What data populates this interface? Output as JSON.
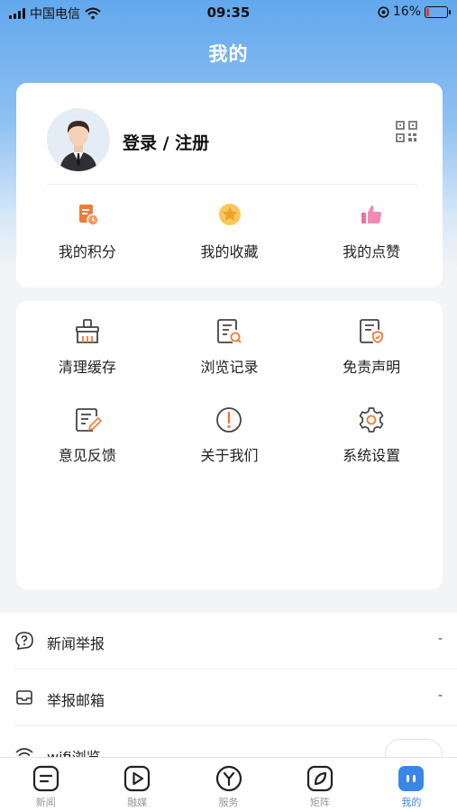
{
  "status_bar": {
    "carrier": "中国电信",
    "time": "09:35",
    "battery_percent": "16%",
    "battery_level": 0.16,
    "battery_color": "#e2402a"
  },
  "header": {
    "title": "我的"
  },
  "profile": {
    "login_label": "登录 / 注册",
    "avatar_icon": "user-avatar-icon",
    "qr_icon": "qr-code-icon"
  },
  "stats": [
    {
      "label": "我的积分",
      "icon": "points-icon",
      "color": "#f07a3a"
    },
    {
      "label": "我的收藏",
      "icon": "star-icon",
      "color": "#f2a93b"
    },
    {
      "label": "我的点赞",
      "icon": "thumb-up-icon",
      "color": "#ee6fa0"
    }
  ],
  "functions": [
    {
      "label": "清理缓存",
      "icon": "broom-icon"
    },
    {
      "label": "浏览记录",
      "icon": "history-icon"
    },
    {
      "label": "免责声明",
      "icon": "disclaimer-icon"
    },
    {
      "label": "意见反馈",
      "icon": "feedback-icon"
    },
    {
      "label": "关于我们",
      "icon": "info-icon"
    },
    {
      "label": "系统设置",
      "icon": "settings-icon"
    }
  ],
  "list": [
    {
      "label": "新闻举报",
      "value": "-",
      "icon": "report-icon"
    },
    {
      "label": "举报邮箱",
      "value": "-",
      "icon": "mailbox-icon"
    },
    {
      "label": "wifi浏览",
      "icon": "wifi-icon"
    }
  ],
  "tabs": [
    {
      "label": "新闻",
      "icon": "news-tab-icon"
    },
    {
      "label": "融媒",
      "icon": "media-tab-icon"
    },
    {
      "label": "服务",
      "icon": "service-tab-icon"
    },
    {
      "label": "矩阵",
      "icon": "matrix-tab-icon"
    },
    {
      "label": "我的",
      "icon": "mine-tab-icon",
      "active": true
    }
  ],
  "colors": {
    "accent": "#3a86e8",
    "header_blue": "#63a8ee"
  }
}
